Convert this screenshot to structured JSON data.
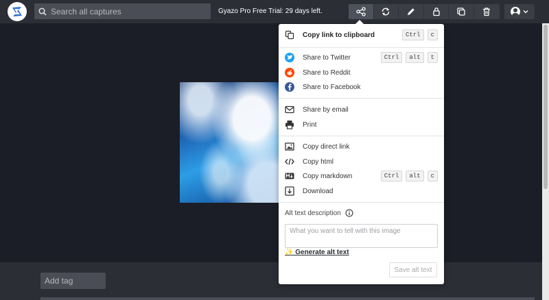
{
  "search": {
    "placeholder": "Search all captures"
  },
  "trial_text": "Gyazo Pro Free Trial: 29 days left.",
  "toolbar": {
    "buttons": [
      "share-icon",
      "sync-icon",
      "pencil-icon",
      "lock-icon",
      "duplicate-icon",
      "trash-icon"
    ]
  },
  "share_menu": {
    "copy_link": {
      "label": "Copy link to clipboard",
      "keys": [
        "Ctrl",
        "c"
      ]
    },
    "share_twitter": {
      "label": "Share to Twitter",
      "keys": [
        "Ctrl",
        "alt",
        "t"
      ],
      "color": "#1da1f2"
    },
    "share_reddit": {
      "label": "Share to Reddit",
      "color": "#ff4500"
    },
    "share_facebook": {
      "label": "Share to Facebook",
      "color": "#3b5998"
    },
    "share_email": {
      "label": "Share by email"
    },
    "print": {
      "label": "Print"
    },
    "copy_direct_link": {
      "label": "Copy direct link"
    },
    "copy_html": {
      "label": "Copy html"
    },
    "copy_markdown": {
      "label": "Copy markdown",
      "keys": [
        "Ctrl",
        "alt",
        "c"
      ]
    },
    "download": {
      "label": "Download"
    },
    "alt_text": {
      "label": "Alt text description",
      "placeholder": "What you want to tell with this image",
      "generate_label": "✨ Generate alt text",
      "save_label": "Save alt text"
    }
  },
  "add_tag": {
    "placeholder": "Add tag"
  }
}
